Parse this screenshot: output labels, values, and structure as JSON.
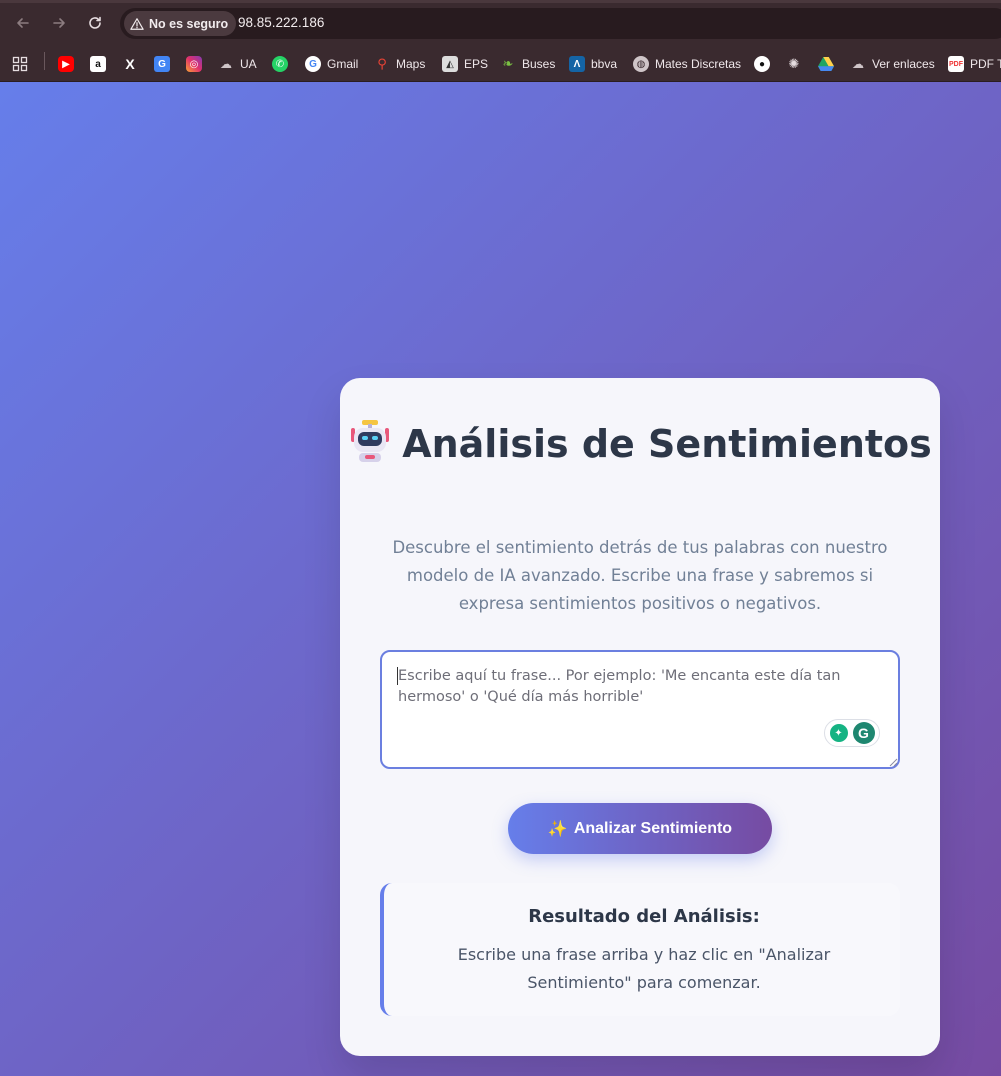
{
  "browser": {
    "security_label": "No es seguro",
    "url": "98.85.222.186",
    "bookmarks": [
      {
        "icon": "youtube-icon",
        "label": ""
      },
      {
        "icon": "amazon-icon",
        "label": ""
      },
      {
        "icon": "x-icon",
        "label": ""
      },
      {
        "icon": "translate-icon",
        "label": ""
      },
      {
        "icon": "instagram-icon",
        "label": ""
      },
      {
        "icon": "cloud-icon",
        "label": "UA"
      },
      {
        "icon": "whatsapp-icon",
        "label": ""
      },
      {
        "icon": "google-icon",
        "label": "Gmail"
      },
      {
        "icon": "maps-icon",
        "label": "Maps"
      },
      {
        "icon": "eps-icon",
        "label": "EPS"
      },
      {
        "icon": "leaf-icon",
        "label": "Buses"
      },
      {
        "icon": "bbva-icon",
        "label": "bbva"
      },
      {
        "icon": "globe-icon",
        "label": "Mates Discretas"
      },
      {
        "icon": "github-icon",
        "label": ""
      },
      {
        "icon": "openai-icon",
        "label": ""
      },
      {
        "icon": "drive-icon",
        "label": ""
      },
      {
        "icon": "cloud-icon",
        "label": "Ver enlaces"
      },
      {
        "icon": "pdf-icon",
        "label": "PDF T"
      }
    ]
  },
  "page": {
    "title_emoji": "robot-icon",
    "title": "Análisis de Sentimientos",
    "subtitle": "Descubre el sentimiento detrás de tus palabras con nuestro modelo de IA avanzado. Escribe una frase y sabremos si expresa sentimientos positivos o negativos.",
    "input_placeholder": "Escribe aquí tu frase... Por ejemplo: 'Me encanta este día tan hermoso' o 'Qué día más horrible'",
    "input_value": "",
    "button_label": "Analizar Sentimiento",
    "result_title": "Resultado del Análisis:",
    "result_text": "Escribe una frase arriba y haz clic en \"Analizar Sentimiento\" para comenzar."
  },
  "colors": {
    "gradient_start": "#667eea",
    "gradient_end": "#764ba2",
    "heading": "#2d3748",
    "muted": "#718096"
  }
}
